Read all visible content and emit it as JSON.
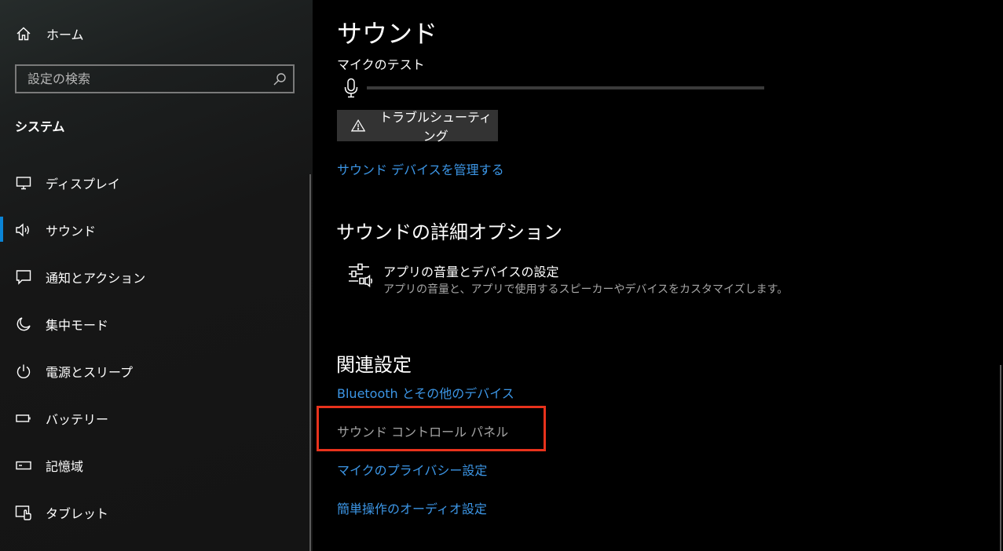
{
  "sidebar": {
    "home_label": "ホーム",
    "search_placeholder": "設定の検索",
    "section_title": "システム",
    "items": [
      {
        "label": "ディスプレイ",
        "icon": "monitor-icon"
      },
      {
        "label": "サウンド",
        "icon": "speaker-icon",
        "active": true
      },
      {
        "label": "通知とアクション",
        "icon": "notification-icon"
      },
      {
        "label": "集中モード",
        "icon": "moon-icon"
      },
      {
        "label": "電源とスリープ",
        "icon": "power-icon"
      },
      {
        "label": "バッテリー",
        "icon": "battery-icon"
      },
      {
        "label": "記憶域",
        "icon": "storage-icon"
      },
      {
        "label": "タブレット",
        "icon": "tablet-icon"
      }
    ]
  },
  "main": {
    "title": "サウンド",
    "mic_test_label": "マイクのテスト",
    "mic_level": 0,
    "troubleshoot_label": "トラブルシューティング",
    "manage_devices_link": "サウンド デバイスを管理する",
    "advanced_heading": "サウンドの詳細オプション",
    "app_volume_title": "アプリの音量とデバイスの設定",
    "app_volume_desc": "アプリの音量と、アプリで使用するスピーカーやデバイスをカスタマイズします。",
    "related_heading": "関連設定",
    "related_links": [
      "Bluetooth とその他のデバイス",
      "サウンド コントロール パネル",
      "マイクのプライバシー設定",
      "簡単操作のオーディオ設定"
    ]
  },
  "colors": {
    "accent": "#0a84d6",
    "link": "#3c96e6",
    "highlight": "#e8321c",
    "background": "#000000",
    "sidebar": "#161616"
  }
}
